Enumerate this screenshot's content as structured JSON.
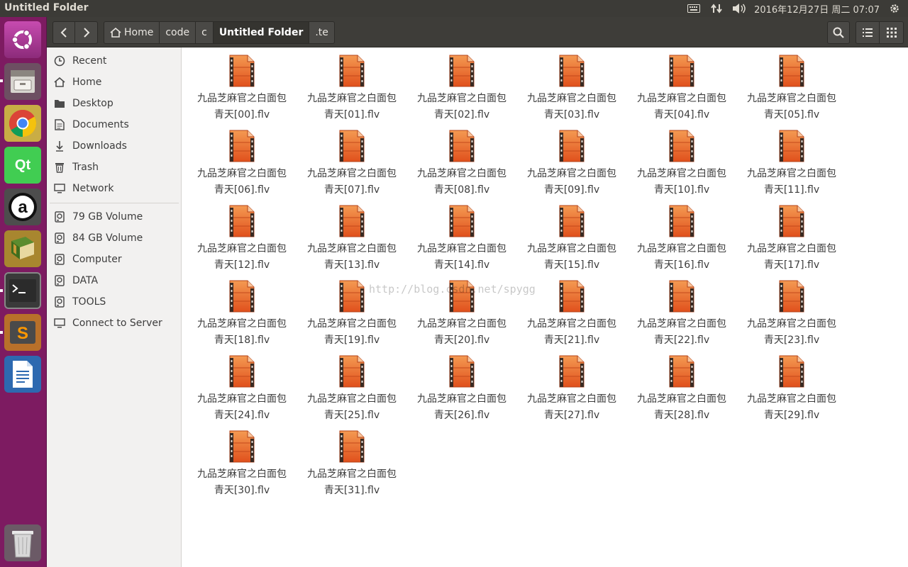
{
  "top_panel": {
    "title": "Untitled Folder",
    "datetime": "2016年12月27日 周二 07:07"
  },
  "launcher": {
    "items": [
      "ubuntu-dash",
      "files",
      "chrome",
      "qt-creator",
      "amarok",
      "book",
      "terminal",
      "sublime-text",
      "writer"
    ],
    "trash": "trash"
  },
  "header": {
    "breadcrumbs": [
      "Home",
      "code",
      "c",
      "Untitled Folder",
      ".te"
    ]
  },
  "sidebar": {
    "places": [
      "Recent",
      "Home",
      "Desktop",
      "Documents",
      "Downloads",
      "Trash",
      "Network"
    ],
    "devices": [
      "79 GB Volume",
      "84 GB Volume",
      "Computer",
      "DATA",
      "TOOLS",
      "Connect to Server"
    ]
  },
  "files": [
    {
      "line1": "九品芝麻官之白面包",
      "line2": "青天[00].flv"
    },
    {
      "line1": "九品芝麻官之白面包",
      "line2": "青天[01].flv"
    },
    {
      "line1": "九品芝麻官之白面包",
      "line2": "青天[02].flv"
    },
    {
      "line1": "九品芝麻官之白面包",
      "line2": "青天[03].flv"
    },
    {
      "line1": "九品芝麻官之白面包",
      "line2": "青天[04].flv"
    },
    {
      "line1": "九品芝麻官之白面包",
      "line2": "青天[05].flv"
    },
    {
      "line1": "九品芝麻官之白面包",
      "line2": "青天[06].flv"
    },
    {
      "line1": "九品芝麻官之白面包",
      "line2": "青天[07].flv"
    },
    {
      "line1": "九品芝麻官之白面包",
      "line2": "青天[08].flv"
    },
    {
      "line1": "九品芝麻官之白面包",
      "line2": "青天[09].flv"
    },
    {
      "line1": "九品芝麻官之白面包",
      "line2": "青天[10].flv"
    },
    {
      "line1": "九品芝麻官之白面包",
      "line2": "青天[11].flv"
    },
    {
      "line1": "九品芝麻官之白面包",
      "line2": "青天[12].flv"
    },
    {
      "line1": "九品芝麻官之白面包",
      "line2": "青天[13].flv"
    },
    {
      "line1": "九品芝麻官之白面包",
      "line2": "青天[14].flv"
    },
    {
      "line1": "九品芝麻官之白面包",
      "line2": "青天[15].flv"
    },
    {
      "line1": "九品芝麻官之白面包",
      "line2": "青天[16].flv"
    },
    {
      "line1": "九品芝麻官之白面包",
      "line2": "青天[17].flv"
    },
    {
      "line1": "九品芝麻官之白面包",
      "line2": "青天[18].flv"
    },
    {
      "line1": "九品芝麻官之白面包",
      "line2": "青天[19].flv"
    },
    {
      "line1": "九品芝麻官之白面包",
      "line2": "青天[20].flv"
    },
    {
      "line1": "九品芝麻官之白面包",
      "line2": "青天[21].flv"
    },
    {
      "line1": "九品芝麻官之白面包",
      "line2": "青天[22].flv"
    },
    {
      "line1": "九品芝麻官之白面包",
      "line2": "青天[23].flv"
    },
    {
      "line1": "九品芝麻官之白面包",
      "line2": "青天[24].flv"
    },
    {
      "line1": "九品芝麻官之白面包",
      "line2": "青天[25].flv"
    },
    {
      "line1": "九品芝麻官之白面包",
      "line2": "青天[26].flv"
    },
    {
      "line1": "九品芝麻官之白面包",
      "line2": "青天[27].flv"
    },
    {
      "line1": "九品芝麻官之白面包",
      "line2": "青天[28].flv"
    },
    {
      "line1": "九品芝麻官之白面包",
      "line2": "青天[29].flv"
    },
    {
      "line1": "九品芝麻官之白面包",
      "line2": "青天[30].flv"
    },
    {
      "line1": "九品芝麻官之白面包",
      "line2": "青天[31].flv"
    }
  ],
  "watermark": "http://blog.csdn.net/spygg",
  "colors": {
    "launcher_bg": "#7d1b61",
    "panel_bg": "#3c3b37",
    "file_icon_orange": "#e8652a"
  }
}
